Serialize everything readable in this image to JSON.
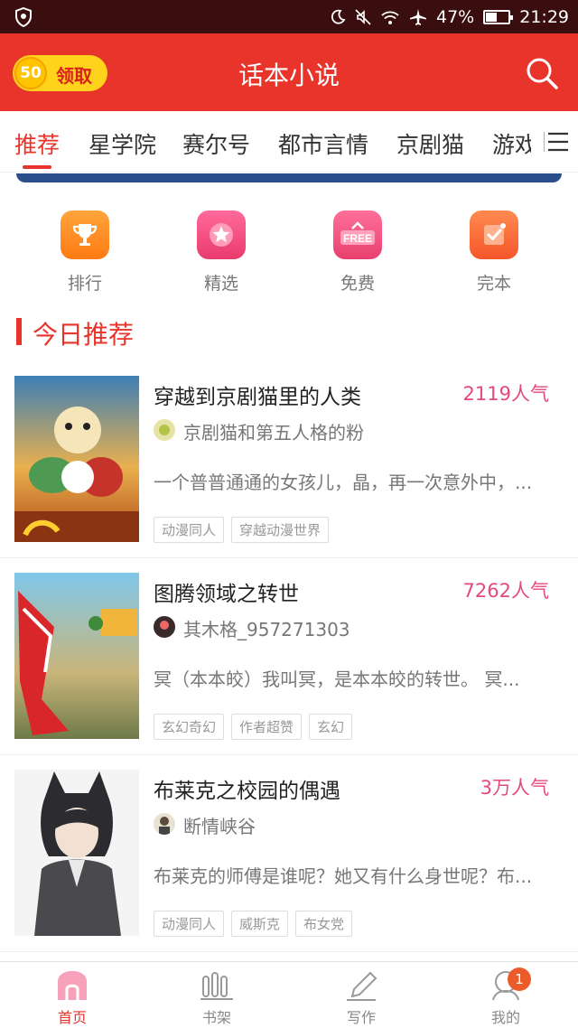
{
  "status_bar": {
    "battery": "47%",
    "time": "21:29",
    "battery_level": 0.47
  },
  "header": {
    "coin_count": "50",
    "coin_label": "领取",
    "title": "话本小说"
  },
  "tabs": [
    {
      "label": "推荐",
      "active": true
    },
    {
      "label": "星学院"
    },
    {
      "label": "赛尔号"
    },
    {
      "label": "都市言情"
    },
    {
      "label": "京剧猫"
    },
    {
      "label": "游戏"
    }
  ],
  "categories": [
    {
      "label": "排行",
      "icon": "trophy-icon",
      "color": "#ff8a1f"
    },
    {
      "label": "精选",
      "icon": "star-icon",
      "color": "#f0457a"
    },
    {
      "label": "免费",
      "icon": "free-icon",
      "color": "#f04e7e",
      "icon_text": "FREE"
    },
    {
      "label": "完本",
      "icon": "check-icon",
      "color": "#fb6a3c"
    }
  ],
  "section": {
    "title": "今日推荐"
  },
  "books": [
    {
      "title": "穿越到京剧猫里的人类",
      "popularity": "2119人气",
      "author": "京剧猫和第五人格的粉",
      "description": "一个普普通通的女孩儿，晶，再一次意外中，...",
      "tags": [
        "动漫同人",
        "穿越动漫世界"
      ]
    },
    {
      "title": "图腾领域之转世",
      "popularity": "7262人气",
      "author": "其木格_957271303",
      "description": "冥（本本皎）我叫冥，是本本皎的转世。 冥...",
      "tags": [
        "玄幻奇幻",
        "作者超赞",
        "玄幻"
      ]
    },
    {
      "title": "布莱克之校园的偶遇",
      "popularity": "3万人气",
      "author": "断情峡谷",
      "description": "布莱克的师傅是谁呢？她又有什么身世呢？布...",
      "tags": [
        "动漫同人",
        "威斯克",
        "布女党"
      ]
    }
  ],
  "bottom_nav": [
    {
      "label": "首页",
      "icon": "home-icon",
      "active": true
    },
    {
      "label": "书架",
      "icon": "bookshelf-icon"
    },
    {
      "label": "写作",
      "icon": "pen-icon"
    },
    {
      "label": "我的",
      "icon": "profile-icon",
      "badge": "1"
    }
  ]
}
